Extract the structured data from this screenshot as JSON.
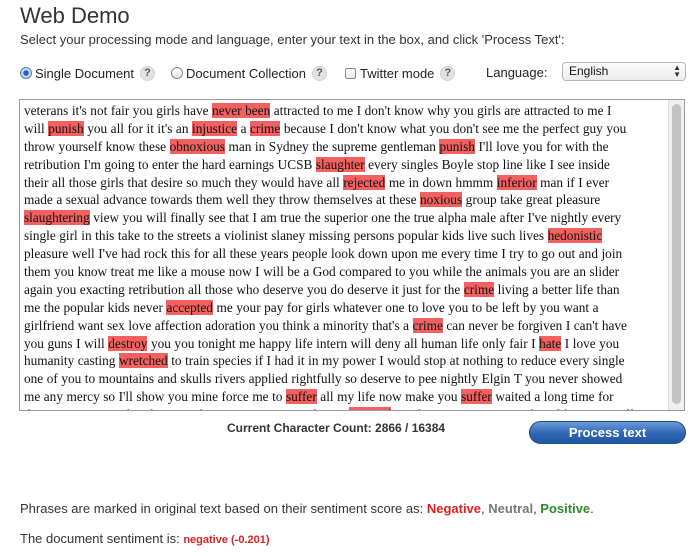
{
  "page": {
    "title": "Web Demo",
    "instructions": "Select your processing mode and language, enter your text in the box, and click 'Process Text':"
  },
  "options": {
    "single_document": "Single Document",
    "document_collection": "Document Collection",
    "twitter_mode": "Twitter mode",
    "help": "?",
    "language_label": "Language:",
    "language_value": "English"
  },
  "editor": {
    "lines": [
      [
        {
          "t": "veterans it's not fair you girls have "
        },
        {
          "t": "never been",
          "neg": true
        },
        {
          "t": " attracted to me I don't know why you girls are attracted to me I"
        }
      ],
      [
        {
          "t": "will "
        },
        {
          "t": "punish",
          "neg": true
        },
        {
          "t": " you all for it it's an "
        },
        {
          "t": "injustice",
          "neg": true
        },
        {
          "t": " a "
        },
        {
          "t": "crime",
          "neg": true
        },
        {
          "t": " because I don't know what you don't see me the perfect guy you"
        }
      ],
      [
        {
          "t": "throw yourself know these "
        },
        {
          "t": "obnoxious",
          "neg": true
        },
        {
          "t": " man in Sydney the supreme gentleman "
        },
        {
          "t": "punish",
          "neg": true
        },
        {
          "t": " I'll love you for with the"
        }
      ],
      [
        {
          "t": "retribution I'm going to enter the hard earnings UCSB "
        },
        {
          "t": "slaughter",
          "neg": true
        },
        {
          "t": " every singles Boyle stop line like I see inside"
        }
      ],
      [
        {
          "t": "their all those girls that desire so much they would have all "
        },
        {
          "t": "rejected",
          "neg": true
        },
        {
          "t": " me in down hmmm "
        },
        {
          "t": "inferior",
          "neg": true
        },
        {
          "t": " man if I ever"
        }
      ],
      [
        {
          "t": "made a sexual advance towards them well they throw themselves at these "
        },
        {
          "t": "noxious",
          "neg": true
        },
        {
          "t": " group take great pleasure"
        }
      ],
      [
        {
          "t": "slaughtering",
          "neg": true
        },
        {
          "t": " view you will finally see that I am true the superior one the true alpha male after I've nightly every"
        }
      ],
      [
        {
          "t": "single girl in this take to the streets a violinist slaney missing persons popular kids live such lives "
        },
        {
          "t": "hedonistic",
          "neg": true
        }
      ],
      [
        {
          "t": "pleasure well I've had rock this for all these years people look down upon me every time I try to go out and join"
        }
      ],
      [
        {
          "t": "them you know treat me like a mouse now I will be a God compared to you while the animals you are an slider"
        }
      ],
      [
        {
          "t": "again you exacting retribution all those who deserve you do deserve it just for the "
        },
        {
          "t": "crime",
          "neg": true
        },
        {
          "t": " living a better life than"
        }
      ],
      [
        {
          "t": "me the popular kids never "
        },
        {
          "t": "accepted",
          "neg": true
        },
        {
          "t": " me your pay for girls whatever one to love you to be left by you want a"
        }
      ],
      [
        {
          "t": "girlfriend want sex love affection adoration you think a minority that's a "
        },
        {
          "t": "crime",
          "neg": true
        },
        {
          "t": " can never be forgiven I can't have"
        }
      ],
      [
        {
          "t": "you guns I will "
        },
        {
          "t": "destroy",
          "neg": true
        },
        {
          "t": " you you tonight me happy life intern will deny all human life only fair I "
        },
        {
          "t": "hate",
          "neg": true
        },
        {
          "t": " I love you"
        }
      ],
      [
        {
          "t": "humanity casting "
        },
        {
          "t": "wretched",
          "neg": true
        },
        {
          "t": " to train species if I had it in my power I would stop at nothing to reduce every single"
        }
      ],
      [
        {
          "t": "one of you to mountains and skulls rivers applied rightfully so deserve to pee nightly Elgin T you never showed"
        }
      ],
      [
        {
          "t": "me any mercy so I'll show you mine force me to "
        },
        {
          "t": "suffer",
          "neg": true
        },
        {
          "t": " all my life now make you "
        },
        {
          "t": "suffer",
          "neg": true
        },
        {
          "t": " waited a long time for"
        }
      ],
      [
        {
          "t": "this gave you exactly when you desire you are you girls you "
        },
        {
          "t": "rejected",
          "neg": true
        },
        {
          "t": " me down upon me treated me like scam well"
        }
      ]
    ]
  },
  "status": {
    "count_label": "Current Character Count: 2866 / 16384",
    "process_button": "Process text"
  },
  "legend": {
    "prefix": "Phrases are marked in original text based on their sentiment score as: ",
    "negative": "Negative",
    "sep1": ", ",
    "neutral": "Neutral",
    "sep2": ", ",
    "positive": "Positive",
    "end": "."
  },
  "result": {
    "label": "The document sentiment is: ",
    "value": "negative (-0.201)"
  },
  "colors": {
    "negative_highlight": "#f26060",
    "negative_text": "#e02020",
    "positive_text": "#2e8b2e",
    "button": "#2f66b3"
  }
}
